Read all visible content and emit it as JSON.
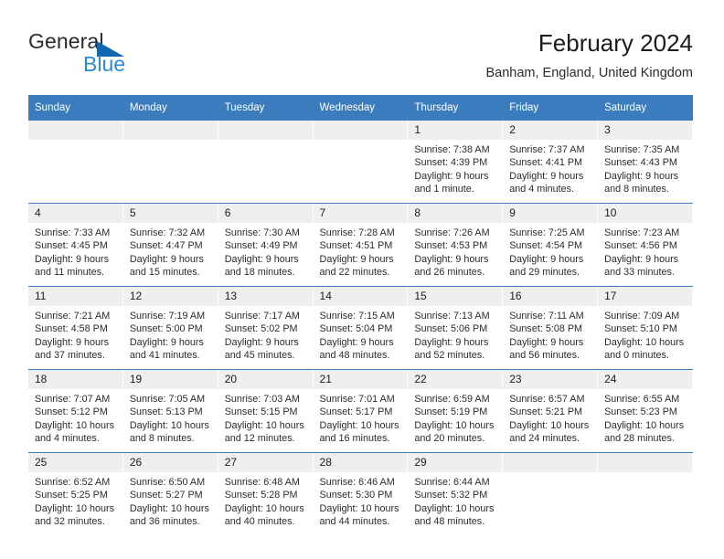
{
  "brand": {
    "name_part1": "General",
    "name_part2": "Blue",
    "accent_color": "#2a8bd5",
    "triangle_color": "#1266b3"
  },
  "header": {
    "title": "February 2024",
    "subtitle": "Banham, England, United Kingdom"
  },
  "theme": {
    "header_blue": "#3b7cbf",
    "daynum_band": "#efefef",
    "text": "#2b2b2b"
  },
  "weekdays": [
    "Sunday",
    "Monday",
    "Tuesday",
    "Wednesday",
    "Thursday",
    "Friday",
    "Saturday"
  ],
  "labels": {
    "sunrise": "Sunrise:",
    "sunset": "Sunset:",
    "daylight": "Daylight:"
  },
  "weeks": [
    [
      {
        "day": "",
        "lines": []
      },
      {
        "day": "",
        "lines": []
      },
      {
        "day": "",
        "lines": []
      },
      {
        "day": "",
        "lines": []
      },
      {
        "day": "1",
        "lines": [
          "Sunrise: 7:38 AM",
          "Sunset: 4:39 PM",
          "Daylight: 9 hours",
          "and 1 minute."
        ]
      },
      {
        "day": "2",
        "lines": [
          "Sunrise: 7:37 AM",
          "Sunset: 4:41 PM",
          "Daylight: 9 hours",
          "and 4 minutes."
        ]
      },
      {
        "day": "3",
        "lines": [
          "Sunrise: 7:35 AM",
          "Sunset: 4:43 PM",
          "Daylight: 9 hours",
          "and 8 minutes."
        ]
      }
    ],
    [
      {
        "day": "4",
        "lines": [
          "Sunrise: 7:33 AM",
          "Sunset: 4:45 PM",
          "Daylight: 9 hours",
          "and 11 minutes."
        ]
      },
      {
        "day": "5",
        "lines": [
          "Sunrise: 7:32 AM",
          "Sunset: 4:47 PM",
          "Daylight: 9 hours",
          "and 15 minutes."
        ]
      },
      {
        "day": "6",
        "lines": [
          "Sunrise: 7:30 AM",
          "Sunset: 4:49 PM",
          "Daylight: 9 hours",
          "and 18 minutes."
        ]
      },
      {
        "day": "7",
        "lines": [
          "Sunrise: 7:28 AM",
          "Sunset: 4:51 PM",
          "Daylight: 9 hours",
          "and 22 minutes."
        ]
      },
      {
        "day": "8",
        "lines": [
          "Sunrise: 7:26 AM",
          "Sunset: 4:53 PM",
          "Daylight: 9 hours",
          "and 26 minutes."
        ]
      },
      {
        "day": "9",
        "lines": [
          "Sunrise: 7:25 AM",
          "Sunset: 4:54 PM",
          "Daylight: 9 hours",
          "and 29 minutes."
        ]
      },
      {
        "day": "10",
        "lines": [
          "Sunrise: 7:23 AM",
          "Sunset: 4:56 PM",
          "Daylight: 9 hours",
          "and 33 minutes."
        ]
      }
    ],
    [
      {
        "day": "11",
        "lines": [
          "Sunrise: 7:21 AM",
          "Sunset: 4:58 PM",
          "Daylight: 9 hours",
          "and 37 minutes."
        ]
      },
      {
        "day": "12",
        "lines": [
          "Sunrise: 7:19 AM",
          "Sunset: 5:00 PM",
          "Daylight: 9 hours",
          "and 41 minutes."
        ]
      },
      {
        "day": "13",
        "lines": [
          "Sunrise: 7:17 AM",
          "Sunset: 5:02 PM",
          "Daylight: 9 hours",
          "and 45 minutes."
        ]
      },
      {
        "day": "14",
        "lines": [
          "Sunrise: 7:15 AM",
          "Sunset: 5:04 PM",
          "Daylight: 9 hours",
          "and 48 minutes."
        ]
      },
      {
        "day": "15",
        "lines": [
          "Sunrise: 7:13 AM",
          "Sunset: 5:06 PM",
          "Daylight: 9 hours",
          "and 52 minutes."
        ]
      },
      {
        "day": "16",
        "lines": [
          "Sunrise: 7:11 AM",
          "Sunset: 5:08 PM",
          "Daylight: 9 hours",
          "and 56 minutes."
        ]
      },
      {
        "day": "17",
        "lines": [
          "Sunrise: 7:09 AM",
          "Sunset: 5:10 PM",
          "Daylight: 10 hours",
          "and 0 minutes."
        ]
      }
    ],
    [
      {
        "day": "18",
        "lines": [
          "Sunrise: 7:07 AM",
          "Sunset: 5:12 PM",
          "Daylight: 10 hours",
          "and 4 minutes."
        ]
      },
      {
        "day": "19",
        "lines": [
          "Sunrise: 7:05 AM",
          "Sunset: 5:13 PM",
          "Daylight: 10 hours",
          "and 8 minutes."
        ]
      },
      {
        "day": "20",
        "lines": [
          "Sunrise: 7:03 AM",
          "Sunset: 5:15 PM",
          "Daylight: 10 hours",
          "and 12 minutes."
        ]
      },
      {
        "day": "21",
        "lines": [
          "Sunrise: 7:01 AM",
          "Sunset: 5:17 PM",
          "Daylight: 10 hours",
          "and 16 minutes."
        ]
      },
      {
        "day": "22",
        "lines": [
          "Sunrise: 6:59 AM",
          "Sunset: 5:19 PM",
          "Daylight: 10 hours",
          "and 20 minutes."
        ]
      },
      {
        "day": "23",
        "lines": [
          "Sunrise: 6:57 AM",
          "Sunset: 5:21 PM",
          "Daylight: 10 hours",
          "and 24 minutes."
        ]
      },
      {
        "day": "24",
        "lines": [
          "Sunrise: 6:55 AM",
          "Sunset: 5:23 PM",
          "Daylight: 10 hours",
          "and 28 minutes."
        ]
      }
    ],
    [
      {
        "day": "25",
        "lines": [
          "Sunrise: 6:52 AM",
          "Sunset: 5:25 PM",
          "Daylight: 10 hours",
          "and 32 minutes."
        ]
      },
      {
        "day": "26",
        "lines": [
          "Sunrise: 6:50 AM",
          "Sunset: 5:27 PM",
          "Daylight: 10 hours",
          "and 36 minutes."
        ]
      },
      {
        "day": "27",
        "lines": [
          "Sunrise: 6:48 AM",
          "Sunset: 5:28 PM",
          "Daylight: 10 hours",
          "and 40 minutes."
        ]
      },
      {
        "day": "28",
        "lines": [
          "Sunrise: 6:46 AM",
          "Sunset: 5:30 PM",
          "Daylight: 10 hours",
          "and 44 minutes."
        ]
      },
      {
        "day": "29",
        "lines": [
          "Sunrise: 6:44 AM",
          "Sunset: 5:32 PM",
          "Daylight: 10 hours",
          "and 48 minutes."
        ]
      },
      {
        "day": "",
        "lines": []
      },
      {
        "day": "",
        "lines": []
      }
    ]
  ]
}
